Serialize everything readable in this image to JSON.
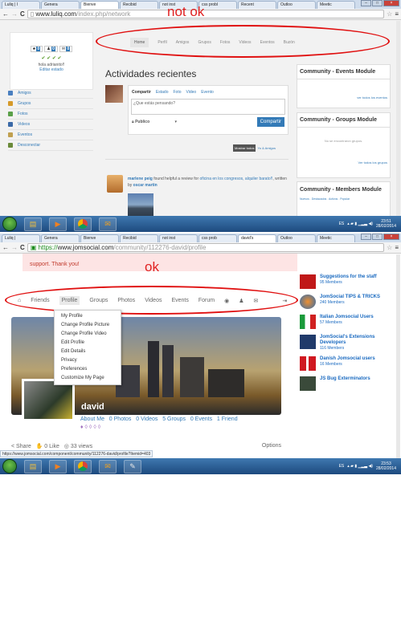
{
  "shot1": {
    "tabs": [
      "Luliq | I",
      "Genera",
      "Bienve",
      "Recibid",
      "not inst",
      "css probl",
      "Recent",
      "Outloo",
      "Meetic"
    ],
    "url_domain": "www.luliq.com",
    "url_path": "/index.php/network",
    "annotation": "not ok",
    "nav": [
      "Home",
      "Perfil",
      "Amigos",
      "Grupos",
      "Fotos",
      "Videos",
      "Eventos",
      "Buzón"
    ],
    "profile": {
      "greeting": "hola adrianito!!",
      "edit": "Editar estado",
      "badges": [
        "0",
        "0",
        "0"
      ]
    },
    "sidebar": [
      "Amigos",
      "Grupos",
      "Fotos",
      "Videos",
      "Eventos",
      "Desconectar"
    ],
    "activity_title": "Actividades recientes",
    "composer": {
      "tabs": [
        "Compartir",
        "Estado",
        "Foto",
        "Video",
        "Evento"
      ],
      "placeholder": "¿Que estás pensando?",
      "privacy": "Publico",
      "share": "Compartir"
    },
    "filters": {
      "all": "Mostrar todos",
      "friends": "Yo & Amigos"
    },
    "post": {
      "author": "marlene peig",
      "text1": "found helpful a review for",
      "link1": "oficina en los congresos, alquiler barato!!",
      "text2": ", written by",
      "link2": "oscar martin"
    },
    "widgets": {
      "events_title": "Community - Events Module",
      "events_link": "ver todos los eventos",
      "groups_title": "Community - Groups Module",
      "groups_empty": "No se encontraron grupos.",
      "groups_link": "Ver todos los grupos",
      "members_title": "Community - Members Module",
      "members_tabs": "Nuevos . Destacados . Activos . Popular"
    },
    "tray": {
      "lang": "ES",
      "time": "23:51",
      "date": "28/02/2014"
    }
  },
  "shot2": {
    "tabs": [
      "Luliq |",
      "Genera",
      "Bienve",
      "Recibid",
      "not inst",
      "css prob",
      "david's",
      "Outloo",
      "Meetic"
    ],
    "url_domain": "www.jomsocial.com",
    "url_path": "/community/112276-david/profile",
    "annotation": "ok",
    "notice": "support. Thank you!",
    "nav": [
      "Friends",
      "Profile",
      "Groups",
      "Photos",
      "Videos",
      "Events",
      "Forum"
    ],
    "menu": [
      "My Profile",
      "Change Profile Picture",
      "Change Profile Video",
      "Edit Profile",
      "Edit Details",
      "Privacy",
      "Preferences",
      "Customize My Page"
    ],
    "user": "david",
    "stats": "About Me   0 Photos   0 Videos   5 Groups   0 Events   1 Friend",
    "actions": {
      "share": "Share",
      "like": "0 Like",
      "views": "33 views",
      "options": "Options"
    },
    "status_url": "https://www.jomsocial.com/component/community/112276-david/profile?Itemid=403",
    "groups": [
      {
        "name": "Suggestions for the staff",
        "members": "95 Members"
      },
      {
        "name": "JomSocial TIPS & TRICKS",
        "members": "240 Members"
      },
      {
        "name": "Italian Jomsocial Users",
        "members": "57 Members"
      },
      {
        "name": "JomSocial's Extensions Developers",
        "members": "116 Members"
      },
      {
        "name": "Danish Jomsocial users",
        "members": "16 Members"
      },
      {
        "name": "JS Bug Exterminators",
        "members": ""
      }
    ],
    "tray": {
      "lang": "ES",
      "time": "23:53",
      "date": "28/02/2014"
    }
  }
}
